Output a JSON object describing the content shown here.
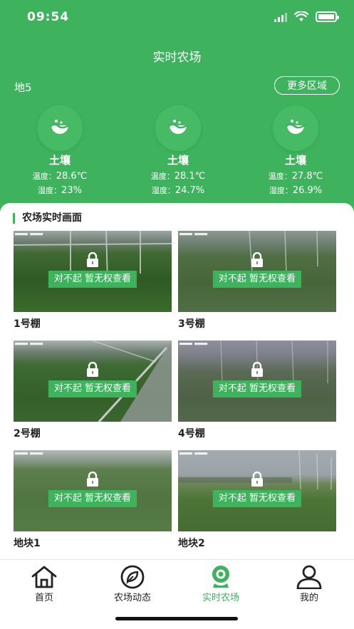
{
  "status_bar": {
    "time": "09:54"
  },
  "header": {
    "title": "实时农场",
    "area": "地5",
    "more_button": "更多区域"
  },
  "sensors": [
    {
      "name": "土壤",
      "temp_label": "温度：",
      "temp_value": "28.6℃",
      "humid_label": "湿度：",
      "humid_value": "23%"
    },
    {
      "name": "土壤",
      "temp_label": "温度：",
      "temp_value": "28.1℃",
      "humid_label": "湿度：",
      "humid_value": "24.7%"
    },
    {
      "name": "土壤",
      "temp_label": "温度：",
      "temp_value": "27.8℃",
      "humid_label": "湿度：",
      "humid_value": "26.9%"
    }
  ],
  "section": {
    "title": "农场实时画面"
  },
  "cameras": [
    {
      "name": "1号棚",
      "message": "对不起 暂无权查看"
    },
    {
      "name": "3号棚",
      "message": "对不起 暂无权查看"
    },
    {
      "name": "2号棚",
      "message": "对不起 暂无权查看"
    },
    {
      "name": "4号棚",
      "message": "对不起 暂无权查看"
    },
    {
      "name": "地块1",
      "message": "对不起 暂无权查看"
    },
    {
      "name": "地块2",
      "message": "对不起 暂无权查看"
    }
  ],
  "tabbar": {
    "items": [
      {
        "label": "首页",
        "icon": "home-icon"
      },
      {
        "label": "农场动态",
        "icon": "leaf-icon"
      },
      {
        "label": "实时农场",
        "icon": "camera-icon",
        "active": true
      },
      {
        "label": "我的",
        "icon": "user-icon"
      }
    ]
  },
  "colors": {
    "accent": "#3fb25e"
  }
}
